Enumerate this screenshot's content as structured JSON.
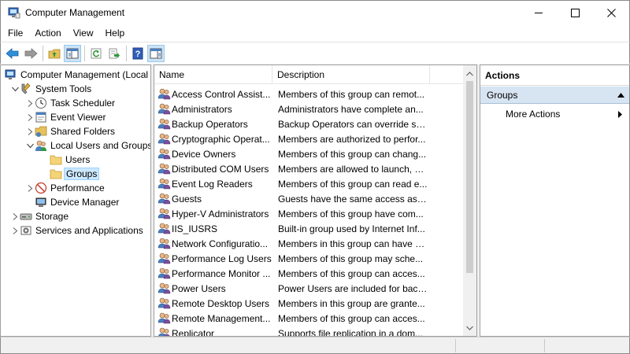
{
  "window": {
    "title": "Computer Management",
    "controls": [
      "minimize-icon",
      "maximize-icon",
      "close-icon"
    ]
  },
  "menu": [
    "File",
    "Action",
    "View",
    "Help"
  ],
  "toolbar": {
    "buttons": [
      "back-arrow-icon",
      "forward-arrow-icon",
      "up-folder-icon",
      "show-hide-tree-icon",
      "refresh-icon",
      "export-list-icon",
      "help-icon",
      "show-hide-action-pane-icon"
    ]
  },
  "tree": {
    "items": [
      {
        "label": "Computer Management (Local",
        "level": 0,
        "expander": "none",
        "icon": "computer-management-icon"
      },
      {
        "label": "System Tools",
        "level": 1,
        "expander": "expanded",
        "icon": "system-tools-icon"
      },
      {
        "label": "Task Scheduler",
        "level": 2,
        "expander": "collapsed",
        "icon": "clock-icon"
      },
      {
        "label": "Event Viewer",
        "level": 2,
        "expander": "collapsed",
        "icon": "event-viewer-icon"
      },
      {
        "label": "Shared Folders",
        "level": 2,
        "expander": "collapsed",
        "icon": "shared-folders-icon"
      },
      {
        "label": "Local Users and Groups",
        "level": 2,
        "expander": "expanded",
        "icon": "users-icon"
      },
      {
        "label": "Users",
        "level": 3,
        "expander": "none",
        "icon": "folder-icon"
      },
      {
        "label": "Groups",
        "level": 3,
        "expander": "none",
        "icon": "folder-icon",
        "selected": true
      },
      {
        "label": "Performance",
        "level": 2,
        "expander": "collapsed",
        "icon": "performance-icon"
      },
      {
        "label": "Device Manager",
        "level": 2,
        "expander": "none",
        "icon": "device-manager-icon"
      },
      {
        "label": "Storage",
        "level": 1,
        "expander": "collapsed",
        "icon": "storage-icon"
      },
      {
        "label": "Services and Applications",
        "level": 1,
        "expander": "collapsed",
        "icon": "services-icon"
      }
    ]
  },
  "list": {
    "columns": {
      "name": "Name",
      "description": "Description"
    },
    "rows": [
      {
        "name": "Access Control Assist...",
        "description": "Members of this group can remot..."
      },
      {
        "name": "Administrators",
        "description": "Administrators have complete an..."
      },
      {
        "name": "Backup Operators",
        "description": "Backup Operators can override se..."
      },
      {
        "name": "Cryptographic Operat...",
        "description": "Members are authorized to perfor..."
      },
      {
        "name": "Device Owners",
        "description": "Members of this group can chang..."
      },
      {
        "name": "Distributed COM Users",
        "description": "Members are allowed to launch, a..."
      },
      {
        "name": "Event Log Readers",
        "description": "Members of this group can read e..."
      },
      {
        "name": "Guests",
        "description": "Guests have the same access as m..."
      },
      {
        "name": "Hyper-V Administrators",
        "description": "Members of this group have com..."
      },
      {
        "name": "IIS_IUSRS",
        "description": "Built-in group used by Internet Inf..."
      },
      {
        "name": "Network Configuratio...",
        "description": "Members in this group can have s..."
      },
      {
        "name": "Performance Log Users",
        "description": "Members of this group may sche..."
      },
      {
        "name": "Performance Monitor ...",
        "description": "Members of this group can acces..."
      },
      {
        "name": "Power Users",
        "description": "Power Users are included for back..."
      },
      {
        "name": "Remote Desktop Users",
        "description": "Members in this group are grante..."
      },
      {
        "name": "Remote Management...",
        "description": "Members of this group can acces..."
      },
      {
        "name": "Replicator",
        "description": "Supports file replication in a dom..."
      }
    ]
  },
  "actions": {
    "title": "Actions",
    "group": "Groups",
    "items": [
      "More Actions"
    ]
  },
  "colors": {
    "selection": "#cce8ff",
    "action_group_bg": "#d7e4f2",
    "toolbar_active": "#cce4f7"
  }
}
